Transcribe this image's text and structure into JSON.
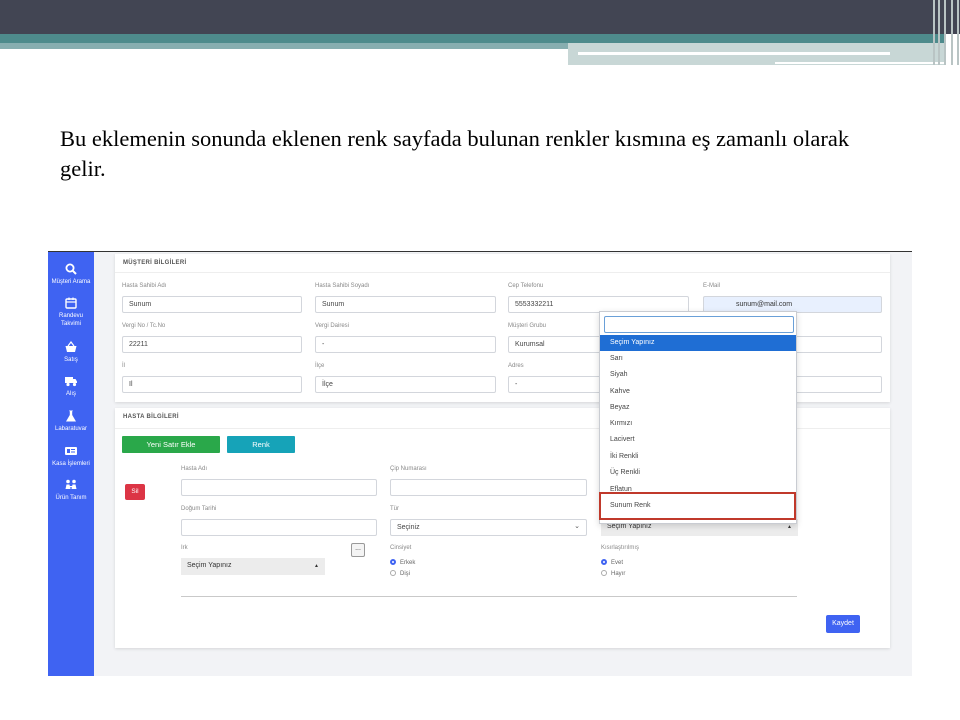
{
  "slide": {
    "text": "Bu eklemenin sonunda eklenen renk sayfada bulunan renkler kısmına eş zamanlı olarak gelir."
  },
  "sidebar": {
    "items": [
      {
        "label": "Müşteri Arama",
        "icon": "search-icon"
      },
      {
        "label": "Randevu Takvimi",
        "icon": "calendar-icon"
      },
      {
        "label": "Satış",
        "icon": "basket-icon"
      },
      {
        "label": "Alış",
        "icon": "truck-icon"
      },
      {
        "label": "Labaratuvar",
        "icon": "flask-icon"
      },
      {
        "label": "Kasa İşlemleri",
        "icon": "cash-icon"
      },
      {
        "label": "Ürün Tanım",
        "icon": "people-icon"
      }
    ]
  },
  "customer": {
    "title": "MÜŞTERİ BİLGİLERİ",
    "owner_name": {
      "label": "Hasta Sahibi Adı",
      "value": "Sunum"
    },
    "owner_surname": {
      "label": "Hasta Sahibi Soyadı",
      "value": "Sunum"
    },
    "phone": {
      "label": "Cep Telefonu",
      "value": "5553332211"
    },
    "email": {
      "label": "E-Mail",
      "value": "sunum@mail.com"
    },
    "tax_no": {
      "label": "Vergi No / Tc.No",
      "value": "22211"
    },
    "tax_office": {
      "label": "Vergi Dairesi",
      "value": "-"
    },
    "customer_group": {
      "label": "Müşteri Grubu",
      "value": "Kurumsal"
    },
    "province": {
      "label": "İl",
      "value": "Il"
    },
    "district": {
      "label": "İlçe",
      "value": "İlçe"
    },
    "address": {
      "label": "Adres",
      "value": "-"
    }
  },
  "patient": {
    "title": "HASTA BİLGİLERİ",
    "add_row_button": "Yeni Satır Ekle",
    "color_button": "Renk",
    "delete_button": "Sil",
    "name_label": "Hasta Adı",
    "chip_label": "Çip Numarası",
    "birth_label": "Doğum Tarihi",
    "species_label": "Tür",
    "species_value": "Seçiniz",
    "color_select_value": "Seçim Yapınız",
    "breed_label": "Irk",
    "breed_value": "Seçim Yapınız",
    "more_button": "...",
    "gender_label": "Cinsiyet",
    "gender_options": [
      "Erkek",
      "Dişi"
    ],
    "neutered_label": "Kısırlaştırılmış",
    "neutered_options": [
      "Evet",
      "Hayır"
    ],
    "save_button": "Kaydet"
  },
  "color_dropdown": {
    "search_value": "",
    "options": [
      "Seçim Yapınız",
      "Sarı",
      "Siyah",
      "Kahve",
      "Beyaz",
      "Kırmızı",
      "Lacivert",
      "İki Renkli",
      "Üç Renkli",
      "Eflatun",
      "Sunum Renk"
    ],
    "selected_index": 0,
    "highlighted_option": "Sunum Renk"
  },
  "colors": {
    "sidebar": "#3f63f2",
    "header_dark": "#424553",
    "teal": "#4e8b8c",
    "highlight": "#c0392b"
  }
}
